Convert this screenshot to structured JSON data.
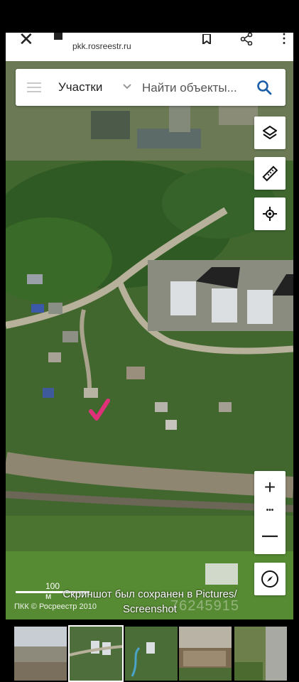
{
  "browser": {
    "url": "pkk.rosreestr.ru"
  },
  "search": {
    "layer_label": "Участки",
    "placeholder": "Найти объекты..."
  },
  "map": {
    "scale_label": "100 м",
    "copyright": "ПКК © Росреестр 2010",
    "marker_color": "#e0307a"
  },
  "zoom": {
    "plus": "+",
    "dots": "•••",
    "minus": "—"
  },
  "toast": {
    "line1": "Скриншот был сохранен в  Pictures/",
    "line2": "Screenshot"
  },
  "watermark": "76245915",
  "icons": [
    "close-icon",
    "bookmark-icon",
    "share-icon",
    "more-icon",
    "menu-icon",
    "chevron-down-icon",
    "search-icon",
    "layers-icon",
    "ruler-icon",
    "locate-icon",
    "compass-icon"
  ]
}
